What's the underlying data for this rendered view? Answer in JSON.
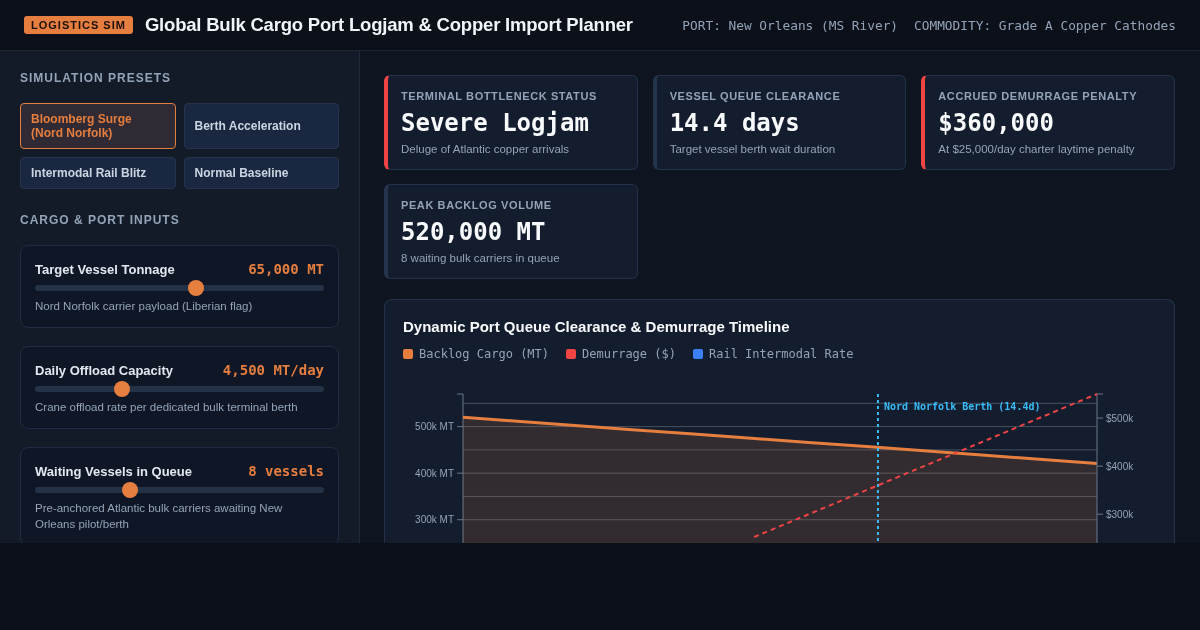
{
  "header": {
    "badge": "LOGISTICS SIM",
    "title": "Global Bulk Cargo Port Logjam & Copper Import Planner",
    "meta": [
      "PORT: New Orleans (MS River)",
      "COMMODITY: Grade A Copper Cathodes"
    ]
  },
  "sidebar": {
    "presets_heading": "SIMULATION PRESETS",
    "presets": [
      {
        "label": "Bloomberg Surge (Nord Norfolk)",
        "selected": true
      },
      {
        "label": "Berth Acceleration",
        "selected": false
      },
      {
        "label": "Intermodal Rail Blitz",
        "selected": false
      },
      {
        "label": "Normal Baseline",
        "selected": false
      }
    ],
    "inputs_heading": "CARGO & PORT INPUTS",
    "inputs": [
      {
        "label": "Target Vessel Tonnage",
        "value": "65,000 MT",
        "level": 0.56,
        "description": "Nord Norfolk carrier payload (Liberian flag)"
      },
      {
        "label": "Daily Offload Capacity",
        "value": "4,500 MT/day",
        "level": 0.29,
        "description": "Crane offload rate per dedicated bulk terminal berth"
      },
      {
        "label": "Waiting Vessels in Queue",
        "value": "8 vessels",
        "level": 0.32,
        "description": "Pre-anchored Atlantic bulk carriers awaiting New Orleans pilot/berth"
      }
    ]
  },
  "kpis": [
    {
      "label": "TERMINAL BOTTLENECK STATUS",
      "value": "Severe Logjam",
      "note": "Deluge of Atlantic copper arrivals",
      "alert": true
    },
    {
      "label": "VESSEL QUEUE CLEARANCE",
      "value": "14.4 days",
      "note": "Target vessel berth wait duration",
      "alert": false
    },
    {
      "label": "ACCRUED DEMURRAGE PENALTY",
      "value": "$360,000",
      "note": "At $25,000/day charter laytime penalty",
      "alert": true
    },
    {
      "label": "PEAK BACKLOG VOLUME",
      "value": "520,000 MT",
      "note": "8 waiting bulk carriers in queue",
      "alert": false
    }
  ],
  "chart": {
    "title": "Dynamic Port Queue Clearance & Demurrage Timeline",
    "layers": [
      {
        "kind": "primary",
        "chart_data": {
          "type": "area",
          "grid": true,
          "categories": [
            null,
            null,
            null,
            null,
            null,
            null,
            null,
            null,
            null,
            null,
            null,
            null
          ],
          "series": [
            {
              "name": "Backlog Cargo (MT)",
              "color": "#e67e3f",
              "values": [
                520000,
                511000,
                502000,
                493000,
                484000,
                475000,
                466000,
                457000,
                448000,
                439000,
                430000,
                421000
              ]
            }
          ],
          "ylim": [
            250000,
            570000
          ],
          "yticks": [
            {
              "value": 300000,
              "label": "300k MT"
            },
            {
              "value": 400000,
              "label": "400k MT"
            },
            {
              "value": 500000,
              "label": "500k MT"
            }
          ],
          "annotations": [
            "Nord Norfolk Berth (14.4d)"
          ]
        }
      },
      {
        "kind": "secondary",
        "chart_data": {
          "type": "line",
          "categories": [
            null,
            null,
            null,
            null,
            null,
            null,
            null
          ],
          "series": [
            {
              "name": "Demurrage ($)",
              "color": "#ef4444",
              "line_style": "dashed",
              "values": [
                250000,
                300000,
                350000,
                400000,
                450000,
                500000,
                550000
              ]
            },
            {
              "name": "Rail Intermodal Rate",
              "color": "#3b82f6",
              "values": [
                null,
                null,
                null,
                null,
                null,
                null,
                null
              ]
            }
          ],
          "ylim": [
            240000,
            550000
          ],
          "yticks": [
            {
              "value": 300000,
              "label": "$300k"
            },
            {
              "value": 400000,
              "label": "$400k"
            },
            {
              "value": 500000,
              "label": "$500k"
            }
          ]
        }
      }
    ]
  }
}
